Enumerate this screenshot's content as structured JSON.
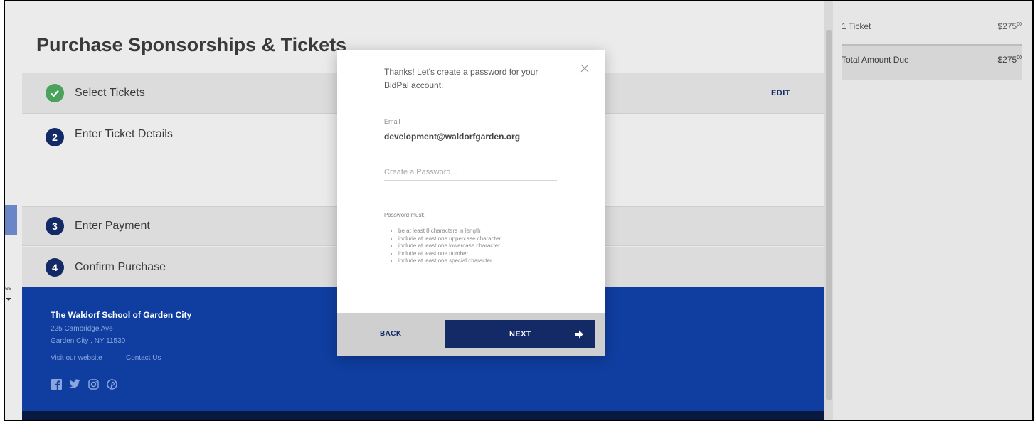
{
  "page": {
    "title": "Purchase Sponsorships & Tickets"
  },
  "steps": [
    {
      "number": "",
      "label": "Select Tickets",
      "state": "complete",
      "edit_label": "EDIT"
    },
    {
      "number": "2",
      "label": "Enter Ticket Details",
      "state": "active"
    },
    {
      "number": "3",
      "label": "Enter Payment",
      "state": "pending"
    },
    {
      "number": "4",
      "label": "Confirm Purchase",
      "state": "pending"
    }
  ],
  "footer": {
    "org_name": "The Waldorf School of Garden City",
    "address_line1": "225 Cambridge Ave",
    "address_line2": "Garden City , NY 11530",
    "links": [
      "Visit our website",
      "Contact Us"
    ],
    "socials": [
      "facebook-icon",
      "twitter-icon",
      "instagram-icon",
      "pinterest-icon"
    ]
  },
  "summary": {
    "line_item_label": "1 Ticket",
    "line_item_amount": "$275",
    "line_item_cents": "00",
    "total_label": "Total Amount Due",
    "total_amount": "$275",
    "total_cents": "00"
  },
  "modal": {
    "heading": "Thanks! Let's create a password for your BidPal account.",
    "email_label": "Email",
    "email_value": "development@waldorfgarden.org",
    "password_placeholder": "Create a Password...",
    "requirements_title": "Password must:",
    "requirements": [
      "be at least 8 characters in length",
      "include at least one uppercase character",
      "include at least one lowercase character",
      "include at least one number",
      "include at least one special character"
    ],
    "back_label": "BACK",
    "next_label": "NEXT"
  },
  "edge": {
    "text": "es"
  },
  "colors": {
    "brand_navy": "#132a66",
    "footer_blue": "#0f3ea0",
    "success_green": "#4aa35b"
  }
}
